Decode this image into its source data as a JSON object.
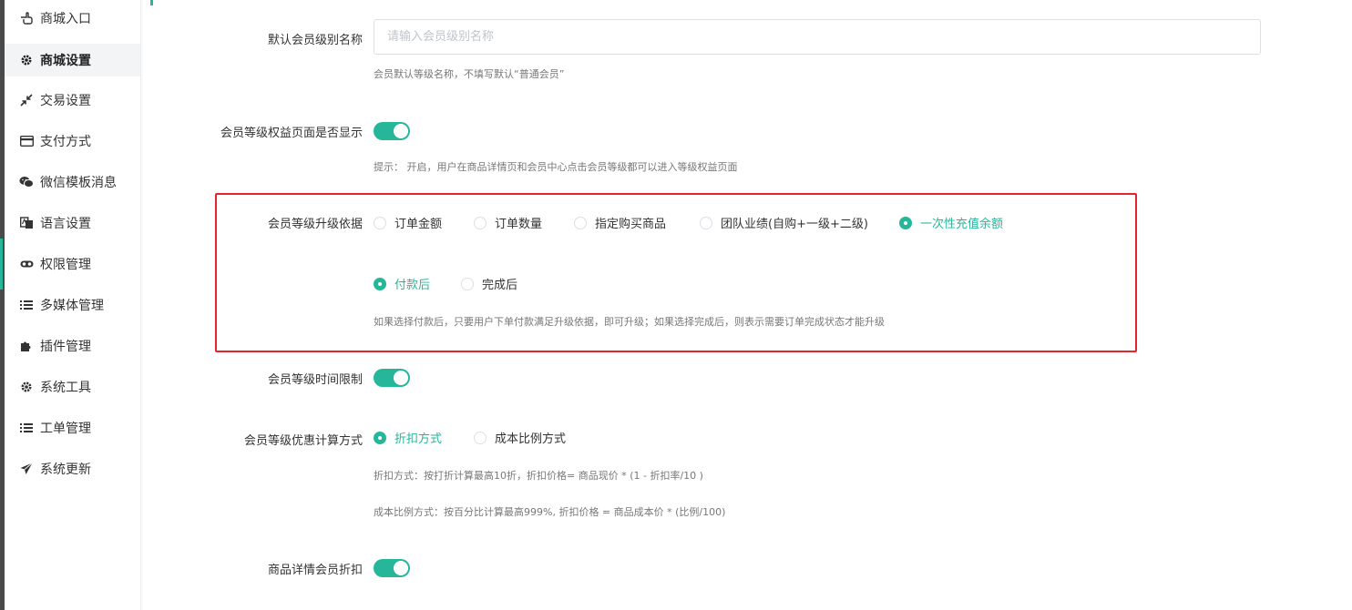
{
  "colors": {
    "accent": "#26b79a",
    "highlight_border": "#e4252f",
    "sidebar_edge": "#4a4a4a"
  },
  "sidebar": {
    "items": [
      {
        "label": "商城入口",
        "icon": "hand-pointer-icon"
      },
      {
        "label": "商城设置",
        "icon": "gear-icon",
        "active": true
      },
      {
        "label": "交易设置",
        "icon": "compress-arrows-icon"
      },
      {
        "label": "支付方式",
        "icon": "credit-card-icon"
      },
      {
        "label": "微信模板消息",
        "icon": "wechat-icon"
      },
      {
        "label": "语言设置",
        "icon": "language-icon"
      },
      {
        "label": "权限管理",
        "icon": "glasses-icon"
      },
      {
        "label": "多媒体管理",
        "icon": "list-icon"
      },
      {
        "label": "插件管理",
        "icon": "puzzle-icon"
      },
      {
        "label": "系统工具",
        "icon": "gear-icon"
      },
      {
        "label": "工单管理",
        "icon": "list-icon"
      },
      {
        "label": "系统更新",
        "icon": "paper-plane-icon"
      }
    ]
  },
  "form": {
    "default_level_name": {
      "label": "默认会员级别名称",
      "value": "",
      "placeholder": "请输入会员级别名称",
      "hint": "会员默认等级名称，不填写默认“普通会员”"
    },
    "level_rights_page": {
      "label": "会员等级权益页面是否显示",
      "enabled": true,
      "hint": "提示： 开启，用户在商品详情页和会员中心点击会员等级都可以进入等级权益页面"
    },
    "upgrade_basis": {
      "label": "会员等级升级依据",
      "options": [
        "订单金额",
        "订单数量",
        "指定购买商品",
        "团队业绩(自购+一级+二级)",
        "一次性充值余额"
      ],
      "selected": "一次性充值余额",
      "timing_options": [
        "付款后",
        "完成后"
      ],
      "timing_selected": "付款后",
      "hint": "如果选择付款后，只要用户下单付款满足升级依据，即可升级；如果选择完成后，则表示需要订单完成状态才能升级"
    },
    "time_limit": {
      "label": "会员等级时间限制",
      "enabled": true
    },
    "discount_calc": {
      "label": "会员等级优惠计算方式",
      "options": [
        "折扣方式",
        "成本比例方式"
      ],
      "selected": "折扣方式",
      "hint_discount": "折扣方式：按打折计算最高10折，折扣价格= 商品现价 * (1 - 折扣率/10 )",
      "hint_cost": "成本比例方式：按百分比计算最高999%, 折扣价格 = 商品成本价 * (比例/100)"
    },
    "detail_discount": {
      "label": "商品详情会员折扣",
      "enabled": true
    }
  }
}
